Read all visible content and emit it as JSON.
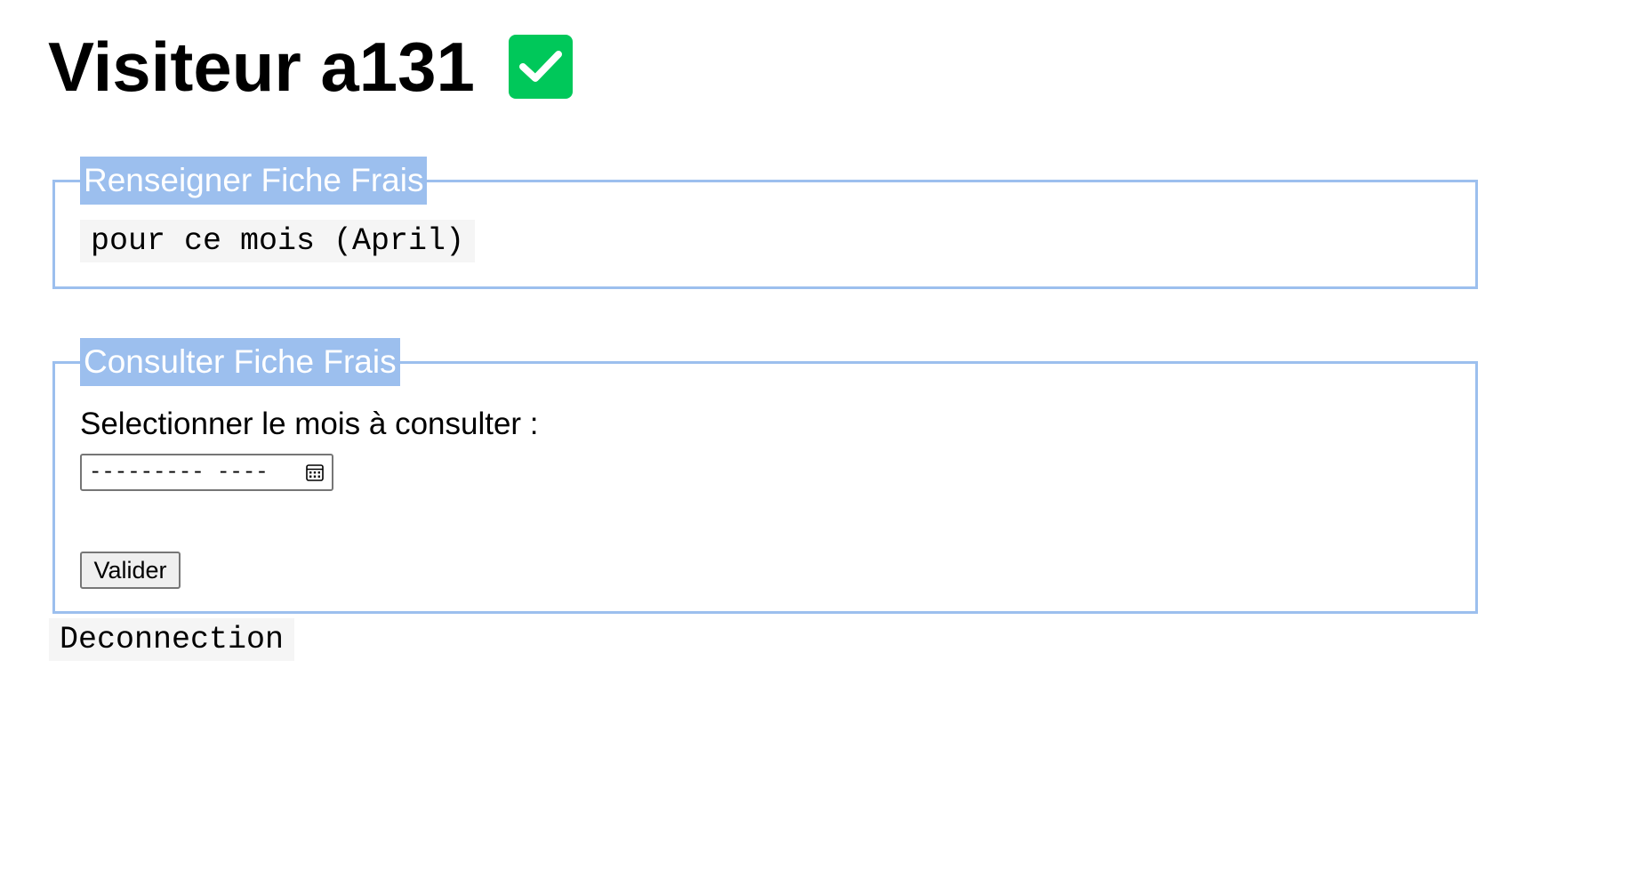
{
  "header": {
    "title": "Visiteur a131",
    "status_icon": "check-icon",
    "status_color": "#00c85a"
  },
  "renseigner": {
    "legend": "Renseigner Fiche Frais",
    "month_link": "pour ce mois (April)"
  },
  "consulter": {
    "legend": "Consulter Fiche Frais",
    "select_label": "Selectionner le mois à consulter :",
    "month_input": {
      "value": "",
      "placeholder": "--------- ----",
      "icon": "calendar-icon"
    },
    "submit_label": "Valider"
  },
  "footer": {
    "logout_link": "Deconnection"
  },
  "theme": {
    "legend_background": "#9cbfee",
    "panel_border": "#9cbfee",
    "legend_text": "#ffffff"
  }
}
